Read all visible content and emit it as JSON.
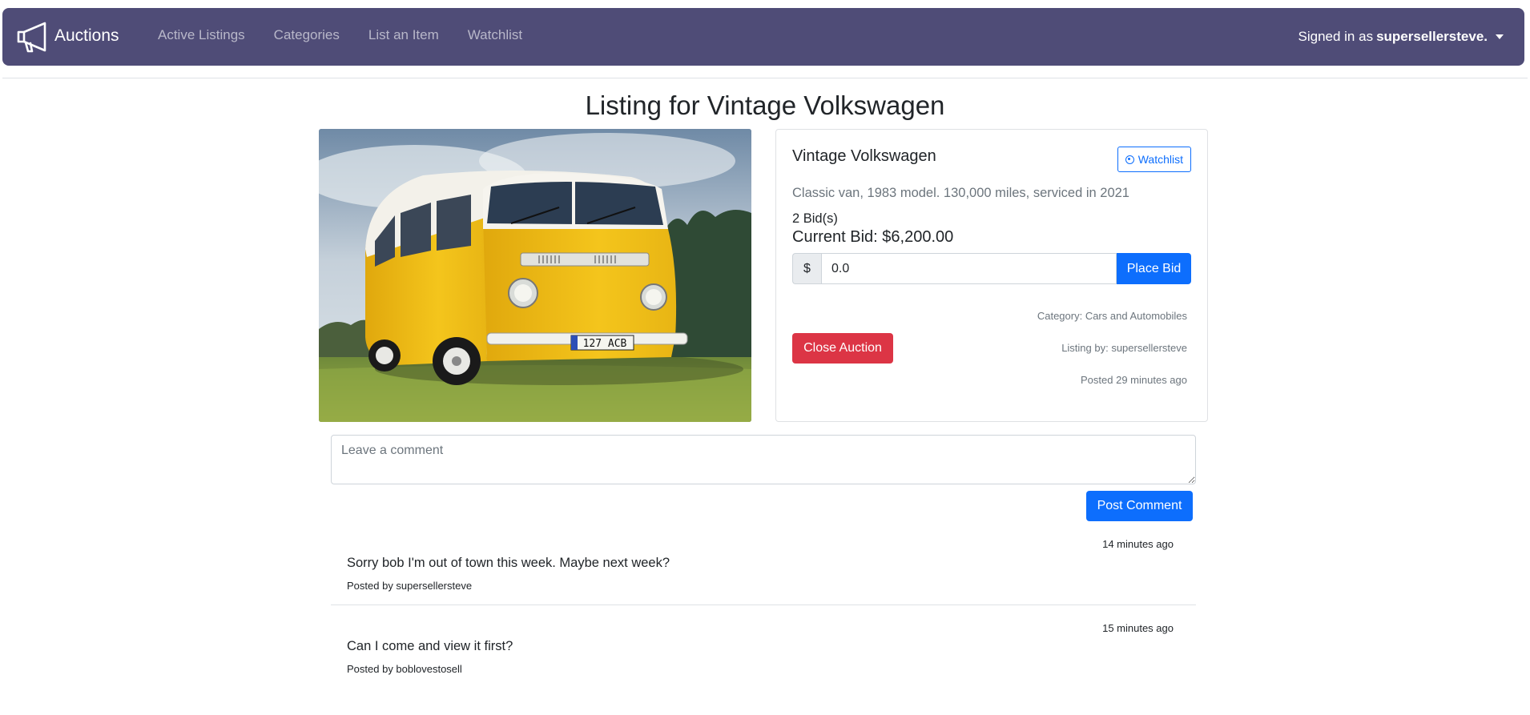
{
  "nav": {
    "brand": "Auctions",
    "links": [
      "Active Listings",
      "Categories",
      "List an Item",
      "Watchlist"
    ],
    "signed_in_prefix": "Signed in as",
    "username": "supersellersteve."
  },
  "page_title": "Listing for Vintage Volkswagen",
  "listing": {
    "title": "Vintage Volkswagen",
    "watchlist_label": "Watchlist",
    "description": "Classic van, 1983 model. 130,000 miles, serviced in 2021",
    "bid_count": "2 Bid(s)",
    "current_bid": "Current Bid: $6,200.00",
    "currency_symbol": "$",
    "bid_value": "0.0",
    "place_bid_label": "Place Bid",
    "category": "Category: Cars and Automobiles",
    "listing_by": "Listing by: supersellersteve",
    "posted": "Posted 29 minutes ago",
    "close_label": "Close Auction",
    "license_plate": "127 ACB"
  },
  "comment_form": {
    "placeholder": "Leave a comment",
    "submit_label": "Post Comment"
  },
  "comments": [
    {
      "time": "14 minutes ago",
      "text": "Sorry bob I'm out of town this week. Maybe next week?",
      "author": "Posted by supersellersteve"
    },
    {
      "time": "15 minutes ago",
      "text": "Can I come and view it first?",
      "author": "Posted by boblovestosell"
    }
  ],
  "colors": {
    "navbar": "#4f4c77",
    "primary": "#0d6efd",
    "danger": "#dc3545",
    "van_yellow": "#f2c21a"
  }
}
